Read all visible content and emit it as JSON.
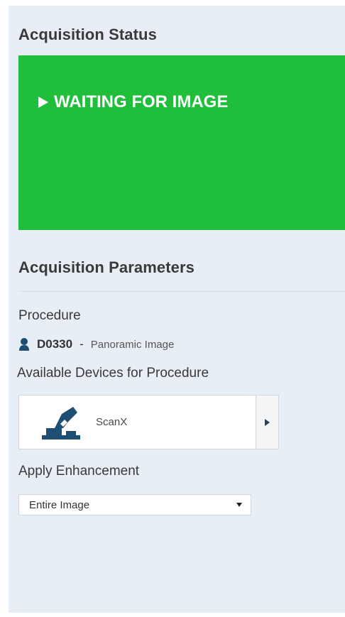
{
  "acquisition_status": {
    "title": "Acquisition Status",
    "status_text": "WAITING FOR IMAGE",
    "status_color": "#1fbf3b"
  },
  "acquisition_parameters": {
    "title": "Acquisition Parameters",
    "procedure_label": "Procedure",
    "procedure": {
      "icon": "person-icon",
      "code": "D0330",
      "separator": "-",
      "description": "Panoramic Image"
    },
    "devices_label": "Available Devices for Procedure",
    "devices": [
      {
        "name": "ScanX",
        "icon": "scanner-icon"
      }
    ],
    "enhancement_label": "Apply Enhancement",
    "enhancement_selected": "Entire Image"
  }
}
